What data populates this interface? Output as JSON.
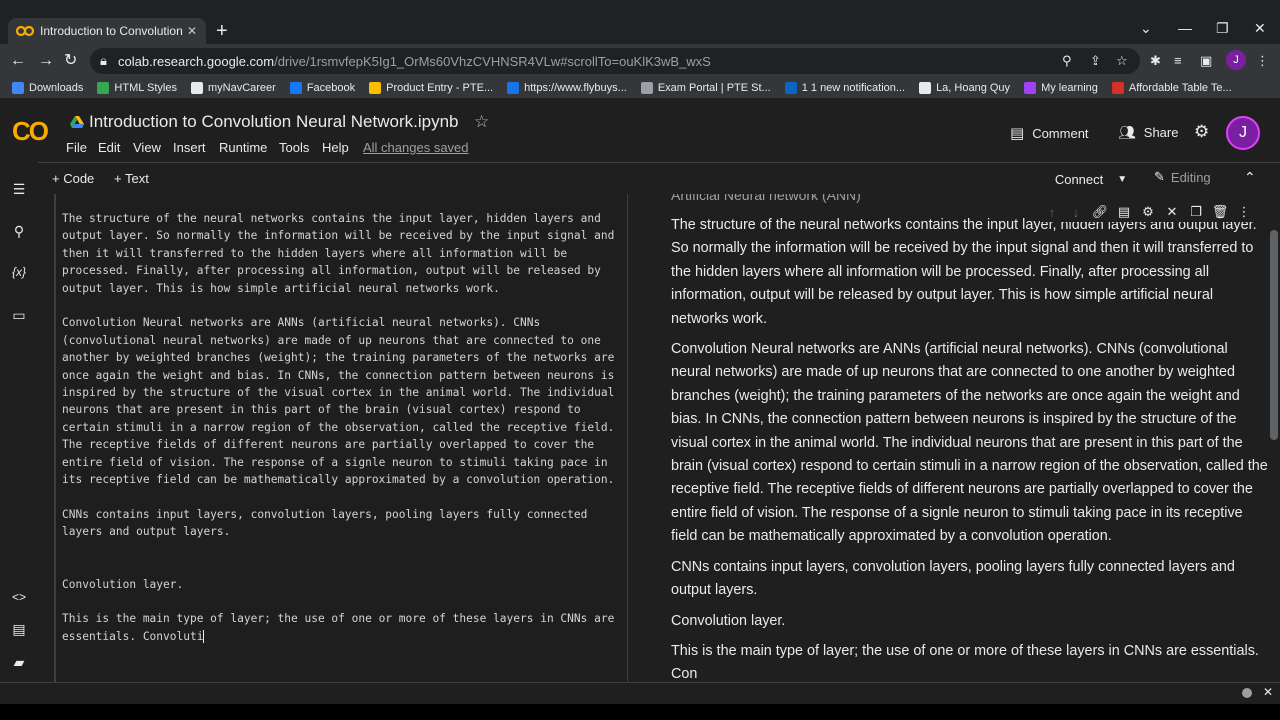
{
  "browser": {
    "tab_title": "Introduction to Convolution Neural Network.ipynb - Colaboratory",
    "tab_favicon_text": "CO",
    "url_host": "colab.research.google.com",
    "url_rest": "/drive/1rsmvfepK5Ig1_OrMs60VhzCVHNSR4VLw#scrollTo=ouKlK3wB_wxS",
    "profile_initial": "J",
    "bookmarks": [
      {
        "label": "Downloads",
        "color": "#4285f4"
      },
      {
        "label": "HTML Styles",
        "color": "#34a853"
      },
      {
        "label": "myNavCareer",
        "color": "#e8eaed"
      },
      {
        "label": "Facebook",
        "color": "#1877f2"
      },
      {
        "label": "Product Entry - PTE...",
        "color": "#fbbc04"
      },
      {
        "label": "https://www.flybuys...",
        "color": "#1a73e8"
      },
      {
        "label": "Exam Portal | PTE St...",
        "color": "#9aa0a6"
      },
      {
        "label": "1 1 new notification...",
        "color": "#0a66c2"
      },
      {
        "label": "La, Hoang Quy",
        "color": "#e8eaed"
      },
      {
        "label": "My learning",
        "color": "#a142f4"
      },
      {
        "label": "Affordable Table Te...",
        "color": "#d93025"
      }
    ]
  },
  "colab": {
    "logo": "CO",
    "notebook_title": "Introduction to Convolution Neural Network.ipynb",
    "menu": [
      "File",
      "Edit",
      "View",
      "Insert",
      "Runtime",
      "Tools",
      "Help"
    ],
    "save_status": "All changes saved",
    "comment_label": "Comment",
    "share_label": "Share",
    "avatar_initial": "J",
    "add_code_label": "+ Code",
    "add_text_label": "+ Text",
    "connect_label": "Connect",
    "editing_label": "Editing"
  },
  "cell": {
    "source_text": "The structure of the neural networks contains the input layer, hidden layers and output layer. So normally the information will be received by the input signal and then it will transferred to the hidden layers where all information will be processed. Finally, after processing all information, output will be released by output layer. This is how simple artificial neural networks work.\n\nConvolution Neural networks are ANNs (artificial neural networks). CNNs (convolutional neural networks) are made of up neurons that are connected to one another by weighted branches (weight); the training parameters of the networks are once again the weight and bias. In CNNs, the connection pattern between neurons is inspired by the structure of the visual cortex in the animal world. The individual neurons that are present in this part of the brain (visual cortex) respond to certain stimuli in a narrow region of the observation, called the receptive field. The receptive fields of different neurons are partially overlapped to cover the entire field of vision. The response of a signle neuron to stimuli taking pace in its receptive field can be mathematically approximated by a convolution operation.\n\nCNNs contains input layers, convolution layers, pooling layers fully connected layers and output layers.\n\n\nConvolution layer.\n\nThis is the main type of layer; the use of one or more of these layers in CNNs are essentials. Convoluti",
    "preview_heading": "Artificial Neural network (ANN)",
    "preview_paragraphs": [
      "The structure of the neural networks contains the input layer, hidden layers and output layer. So normally the information will be received by the input signal and then it will transferred to the hidden layers where all information will be processed. Finally, after processing all information, output will be released by output layer. This is how simple artificial neural networks work.",
      "Convolution Neural networks are ANNs (artificial neural networks). CNNs (convolutional neural networks) are made of up neurons that are connected to one another by weighted branches (weight); the training parameters of the networks are once again the weight and bias. In CNNs, the connection pattern between neurons is inspired by the structure of the visual cortex in the animal world. The individual neurons that are present in this part of the brain (visual cortex) respond to certain stimuli in a narrow region of the observation, called the receptive field. The receptive fields of different neurons are partially overlapped to cover the entire field of vision. The response of a signle neuron to stimuli taking pace in its receptive field can be mathematically approximated by a convolution operation.",
      "CNNs contains input layers, convolution layers, pooling layers fully connected layers and output layers.",
      "Convolution layer.",
      "This is the main type of layer; the use of one or more of these layers in CNNs are essentials. Con"
    ]
  }
}
